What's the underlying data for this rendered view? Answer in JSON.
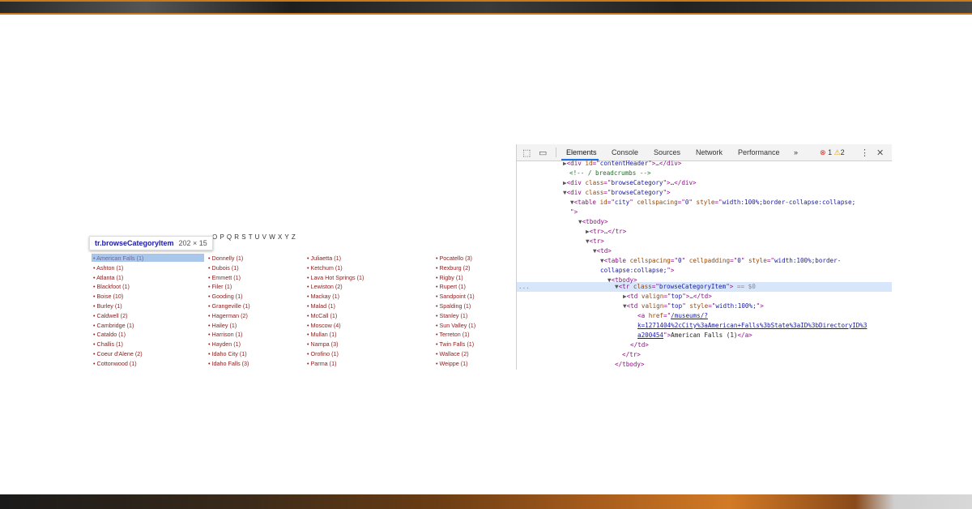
{
  "page": {
    "alphabet": "O P Q R S T U V W X Y Z",
    "tooltip": {
      "selector": "tr.browseCategoryItem",
      "dims": "202 × 15"
    },
    "columns": [
      [
        "• American Falls (1)",
        "• Ashton (1)",
        "• Atlanta (1)",
        "• Blackfoot (1)",
        "• Boise (10)",
        "• Burley (1)",
        "• Caldwell (2)",
        "• Cambridge (1)",
        "• Cataldo (1)",
        "• Challis (1)",
        "• Coeur d'Alene (2)",
        "• Cottonwood (1)"
      ],
      [
        "• Donnelly (1)",
        "• Dubois (1)",
        "• Emmett (1)",
        "• Filer (1)",
        "• Gooding (1)",
        "• Grangeville (1)",
        "• Hagerman (2)",
        "• Hailey (1)",
        "• Harrison (1)",
        "• Hayden (1)",
        "• Idaho City (1)",
        "• Idaho Falls (3)"
      ],
      [
        "• Juliaetta (1)",
        "• Ketchum (1)",
        "• Lava Hot Springs (1)",
        "• Lewiston (2)",
        "• Mackay (1)",
        "• Malad (1)",
        "• McCall (1)",
        "• Moscow (4)",
        "• Mullan (1)",
        "• Nampa (3)",
        "• Orofino (1)",
        "• Parma (1)"
      ],
      [
        "• Pocatello (3)",
        "• Rexburg (2)",
        "• Rigby (1)",
        "• Rupert (1)",
        "• Sandpoint (1)",
        "• Spalding (1)",
        "• Stanley (1)",
        "• Sun Valley (1)",
        "• Terreton (1)",
        "• Twin Falls (1)",
        "• Wallace (2)",
        "• Weippe (1)"
      ]
    ]
  },
  "devtools": {
    "tabs": [
      "Elements",
      "Console",
      "Sources",
      "Network",
      "Performance"
    ],
    "active_tab": "Elements",
    "more": "»",
    "errors": "1",
    "warnings": "2",
    "error_icon": "⊗",
    "warning_icon": "⚠",
    "menu_icon": "⋮",
    "close_icon": "✕",
    "inspect_icon": "⬚",
    "device_icon": "▭",
    "tree": {
      "l1": {
        "tag_open": "<div ",
        "attr": "id",
        "eq": "=\"",
        "val": "contentHeader",
        "close": "\">…</div>"
      },
      "l2": {
        "comment": "<!-- / breadcrumbs -->"
      },
      "l3": {
        "tag_open": "<div ",
        "attr": "class",
        "eq": "=\"",
        "val": "browseCategory",
        "close": "\">…</div>"
      },
      "l4": {
        "tag_open": "<div ",
        "attr": "class",
        "eq": "=\"",
        "val": "browseCategory",
        "close": "\">"
      },
      "l5": {
        "tag_open": "<table ",
        "a1": "id",
        "v1": "city",
        "a2": "cellspacing",
        "v2": "0",
        "a3": "style",
        "v3": "width:100%;border-collapse:collapse;"
      },
      "l5b": {
        "text": "\">"
      },
      "l6": {
        "text": "<tbody>"
      },
      "l7": {
        "text": "<tr>…</tr>"
      },
      "l8": {
        "text": "<tr>"
      },
      "l9": {
        "text": "<td>"
      },
      "l10": {
        "tag_open": "<table ",
        "a1": "cellspacing",
        "v1": "0",
        "a2": "cellpadding",
        "v2": "0",
        "a3": "style",
        "v3": "width:100%;border-"
      },
      "l10b": {
        "val": "collapse:collapse;",
        "close": "\">"
      },
      "l11": {
        "text": "<tbody>"
      },
      "l12": {
        "tag_open": "<tr ",
        "attr": "class",
        "val": "browseCategoryItem",
        "close": "\">",
        "suffix": " == $0",
        "dots": "..."
      },
      "l13": {
        "tag_open": "<td ",
        "attr": "valign",
        "val": "top",
        "close": "\">…</td>"
      },
      "l14": {
        "tag_open": "<td ",
        "a1": "valign",
        "v1": "top",
        "a2": "style",
        "v2": "width:100%;",
        "close": "\">"
      },
      "l15": {
        "tag_open": "<a ",
        "attr": "href",
        "val": "/museums/?"
      },
      "l16": {
        "link": "k=1271404%2cCity%3aAmerican+Falls%3bState%3aID%3bDirectoryID%3"
      },
      "l17": {
        "link": "a200454",
        "close": "\">",
        "text": "American Falls (1)",
        "end": "</a>"
      },
      "l18": {
        "text": "</td>"
      },
      "l19": {
        "text": "</tr>"
      },
      "l20": {
        "text": "</tbody>"
      }
    }
  }
}
